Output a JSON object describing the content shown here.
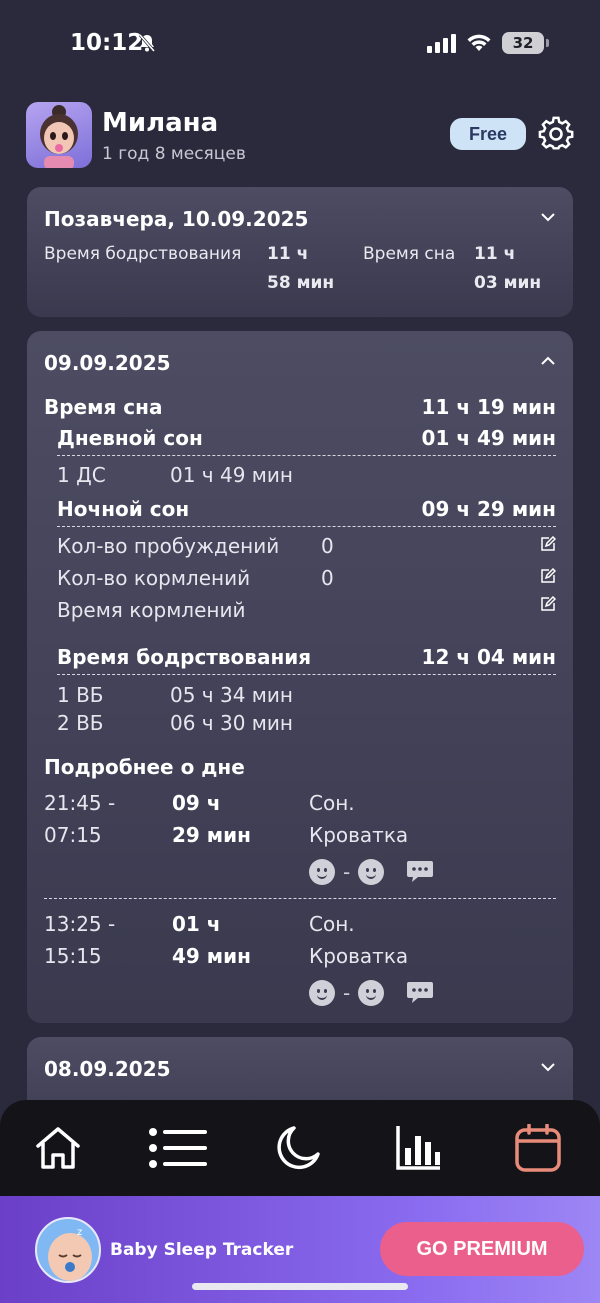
{
  "status_bar": {
    "time": "10:12",
    "battery": "32"
  },
  "profile": {
    "name": "Милана",
    "age": "1 год 8 месяцев",
    "plan_badge": "Free"
  },
  "card_prev": {
    "title": "Позавчера, 10.09.2025",
    "awake_label": "Время бодрствования",
    "awake_value_line1": "11 ч",
    "awake_value_line2": "58 мин",
    "sleep_label": "Время сна",
    "sleep_value_line1": "11 ч",
    "sleep_value_line2": "03 мин"
  },
  "card_day": {
    "title": "09.09.2025",
    "sleep_total_label": "Время сна",
    "sleep_total_value": "11 ч 19 мин",
    "day_sleep_label": "Дневной сон",
    "day_sleep_value": "01 ч 49 мин",
    "day_sleep_items": [
      {
        "label": "1 ДС",
        "value": "01 ч 49 мин"
      }
    ],
    "night_sleep_label": "Ночной сон",
    "night_sleep_value": "09 ч 29 мин",
    "wakeups_label": "Кол-во пробуждений",
    "wakeups_value": "0",
    "feedings_label": "Кол-во кормлений",
    "feedings_value": "0",
    "feeding_time_label": "Время кормлений",
    "awake_total_label": "Время бодрствования",
    "awake_total_value": "12 ч 04 мин",
    "awake_items": [
      {
        "label": "1 ВБ",
        "value": "05 ч 34 мин"
      },
      {
        "label": "2 ВБ",
        "value": "06 ч 30 мин"
      }
    ],
    "details_title": "Подробнее о дне",
    "entries": [
      {
        "time_start": "21:45 -",
        "time_end": "07:15",
        "dur_h": "09 ч",
        "dur_m": "29 мин",
        "type": "Сон.",
        "place": "Кроватка"
      },
      {
        "time_start": "13:25 -",
        "time_end": "15:15",
        "dur_h": "01 ч",
        "dur_m": "49 мин",
        "type": "Сон.",
        "place": "Кроватка"
      }
    ]
  },
  "card_next": {
    "title": "08.09.2025"
  },
  "promo": {
    "app_name": "Baby Sleep Tracker",
    "button": "GO PREMIUM"
  },
  "colors": {
    "background": "#2b2a3c",
    "accent_pink": "#ea5f8c",
    "calendar_active": "#e98b7a",
    "badge": "#cfe3f6"
  },
  "tabs": [
    "home-icon",
    "list-icon",
    "moon-icon",
    "stats-icon",
    "calendar-icon"
  ]
}
